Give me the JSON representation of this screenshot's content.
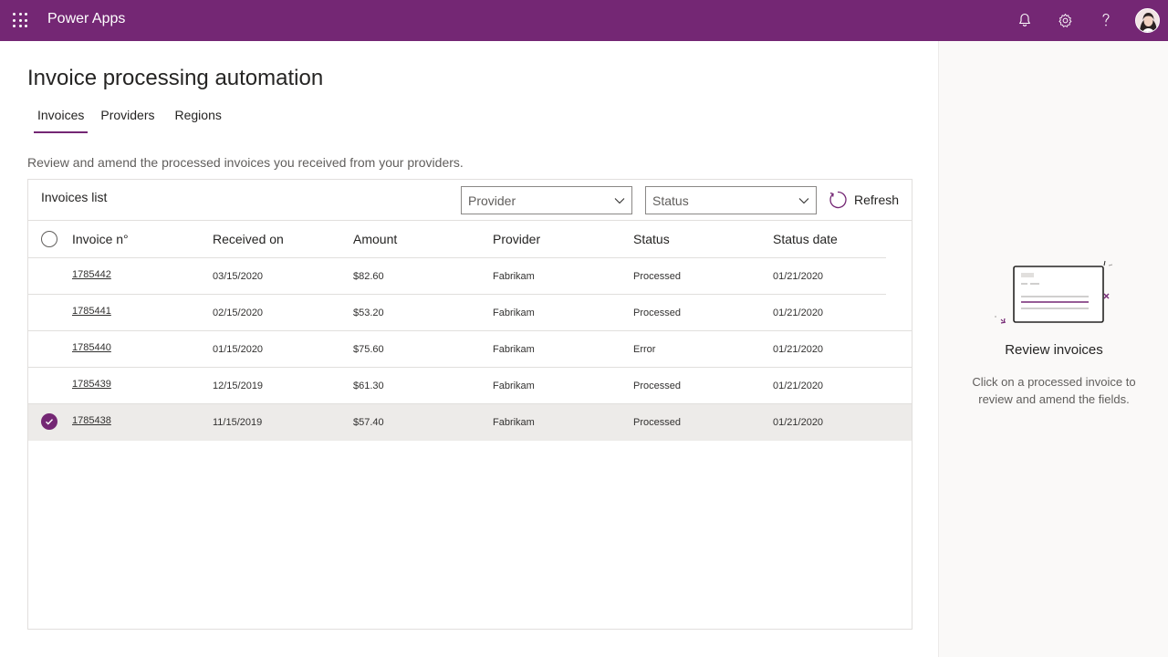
{
  "app": {
    "name": "Power Apps",
    "brand_color": "#742774",
    "icons": [
      "waffle-icon",
      "bell-icon",
      "gear-icon",
      "help-icon"
    ]
  },
  "page": {
    "title": "Invoice processing automation",
    "tabs": [
      {
        "label": "Invoices",
        "active": true
      },
      {
        "label": "Providers",
        "active": false
      },
      {
        "label": "Regions",
        "active": false
      }
    ],
    "description": "Review and amend the processed invoices you received from your providers."
  },
  "invoices_list": {
    "title": "Invoices list",
    "provider_filter": {
      "placeholder": "Provider"
    },
    "status_filter": {
      "placeholder": "Status"
    },
    "refresh_label": "Refresh",
    "columns": [
      "Invoice n°",
      "Received on",
      "Amount",
      "Provider",
      "Status",
      "Status date"
    ],
    "rows": [
      {
        "invoice": "1785442",
        "received": "03/15/2020",
        "amount": "$82.60",
        "provider": "Fabrikam",
        "status": "Processed",
        "status_date": "01/21/2020",
        "selected": false
      },
      {
        "invoice": "1785441",
        "received": "02/15/2020",
        "amount": "$53.20",
        "provider": "Fabrikam",
        "status": "Processed",
        "status_date": "01/21/2020",
        "selected": false
      },
      {
        "invoice": "1785440",
        "received": "01/15/2020",
        "amount": "$75.60",
        "provider": "Fabrikam",
        "status": "Error",
        "status_date": "01/21/2020",
        "selected": false
      },
      {
        "invoice": "1785439",
        "received": "12/15/2019",
        "amount": "$61.30",
        "provider": "Fabrikam",
        "status": "Processed",
        "status_date": "01/21/2020",
        "selected": false
      },
      {
        "invoice": "1785438",
        "received": "11/15/2019",
        "amount": "$57.40",
        "provider": "Fabrikam",
        "status": "Processed",
        "status_date": "01/21/2020",
        "selected": true
      }
    ]
  },
  "side_panel": {
    "title": "Review invoices",
    "text": "Click on a processed invoice to review and amend the fields."
  }
}
